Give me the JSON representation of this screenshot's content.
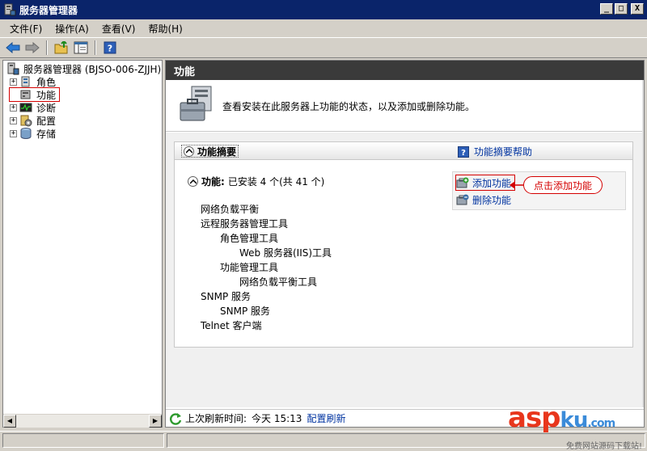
{
  "window": {
    "title": "服务器管理器",
    "controls": [
      "_",
      "□",
      "X"
    ]
  },
  "menu": [
    "文件(F)",
    "操作(A)",
    "查看(V)",
    "帮助(H)"
  ],
  "toolbar": {
    "buttons": [
      "back-arrow-icon",
      "forward-arrow-icon",
      "up-folder-icon",
      "show-hide-tree-icon",
      "help-icon"
    ]
  },
  "tree": {
    "root": "服务器管理器 (BJSO-006-ZJJH)",
    "items": [
      {
        "label": "角色",
        "expander": "+",
        "icon": "roles-icon"
      },
      {
        "label": "功能",
        "expander": "",
        "icon": "features-icon"
      },
      {
        "label": "诊断",
        "expander": "+",
        "icon": "diagnostics-icon"
      },
      {
        "label": "配置",
        "expander": "+",
        "icon": "configuration-icon"
      },
      {
        "label": "存储",
        "expander": "+",
        "icon": "storage-icon"
      }
    ]
  },
  "pane": {
    "header": "功能",
    "intro": "查看安装在此服务器上功能的状态，以及添加或删除功能。",
    "summary_title": "功能摘要",
    "help_link": "功能摘要帮助",
    "features_label": "功能:",
    "features_value": "已安装 4 个(共 41 个)",
    "feature_lines": [
      {
        "text": "网络负载平衡",
        "indent": 0
      },
      {
        "text": "远程服务器管理工具",
        "indent": 0
      },
      {
        "text": "角色管理工具",
        "indent": 1
      },
      {
        "text": "Web 服务器(IIS)工具",
        "indent": 2
      },
      {
        "text": "功能管理工具",
        "indent": 1
      },
      {
        "text": "网络负载平衡工具",
        "indent": 2
      },
      {
        "text": "SNMP 服务",
        "indent": 0
      },
      {
        "text": "SNMP 服务",
        "indent": 1
      },
      {
        "text": "Telnet 客户端",
        "indent": 0
      }
    ],
    "actions": {
      "add": "添加功能",
      "remove": "删除功能"
    },
    "callout": "点击添加功能",
    "refresh": {
      "label": "上次刷新时间:",
      "time": "今天 15:13",
      "configure": "配置刷新"
    }
  },
  "watermark": {
    "brand_a": "asp",
    "brand_b": "ku",
    "brand_c": ".com",
    "sub": "免费网站源码下载站!"
  },
  "colors": {
    "title_bar": "#0a246a",
    "pane_header": "#3a3a3a",
    "link": "#0033a0",
    "annotation": "#d40000"
  }
}
